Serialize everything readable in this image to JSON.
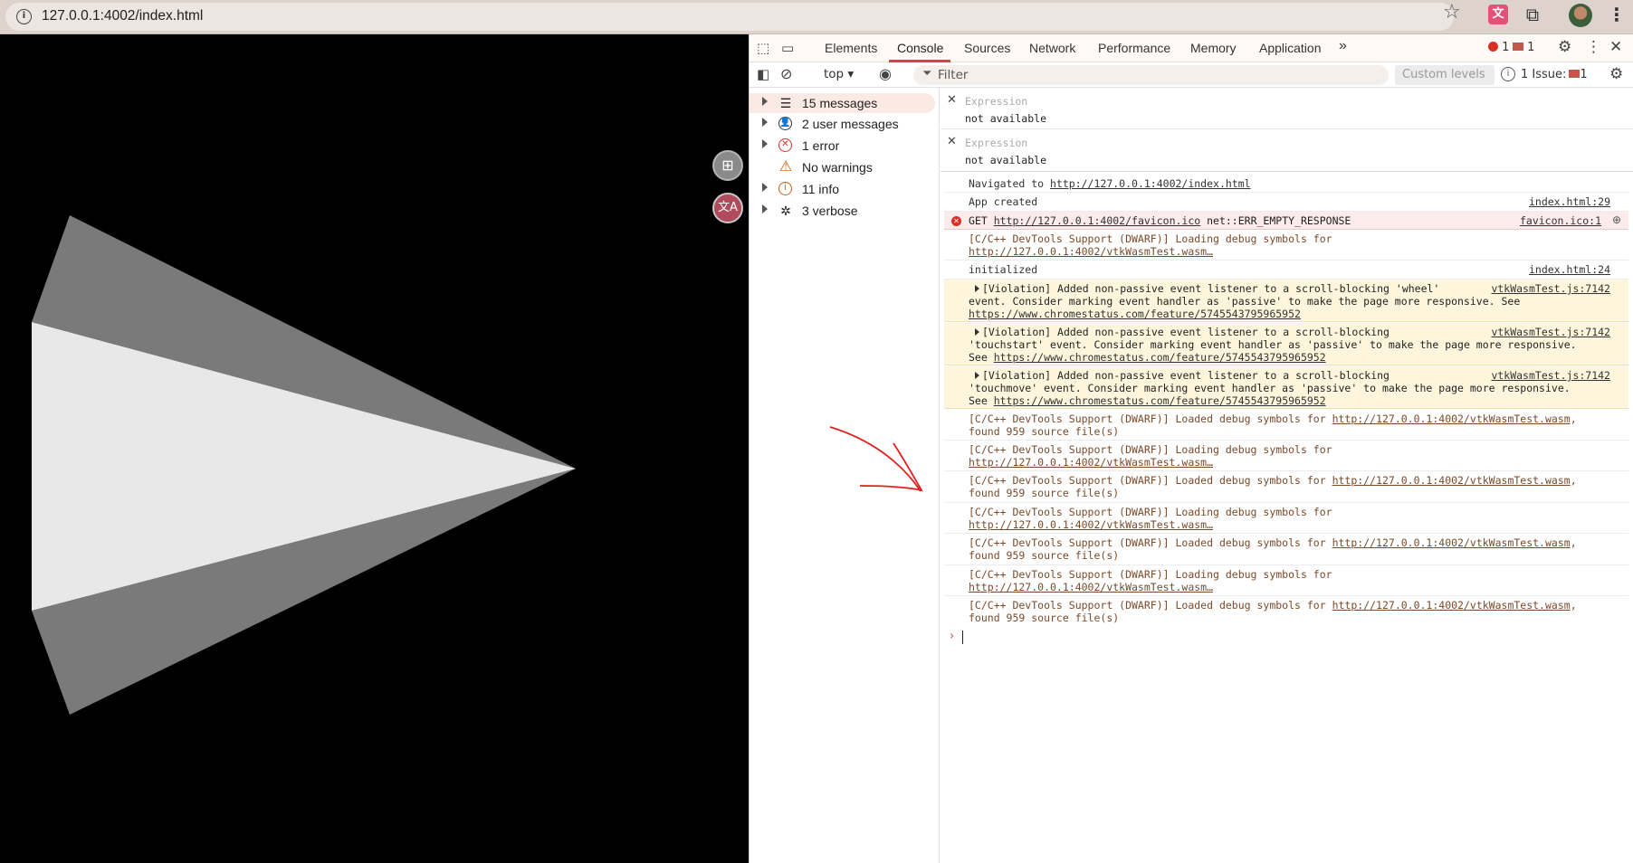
{
  "browser": {
    "url": "127.0.0.1:4002/index.html"
  },
  "devtools": {
    "tabs": [
      "Elements",
      "Console",
      "Sources",
      "Network",
      "Performance",
      "Memory",
      "Application"
    ],
    "active_tab": "Console",
    "more_tabs": "»",
    "error_count": "1",
    "message_count": "1",
    "context": "top ▾",
    "filter_placeholder": "Filter",
    "levels": "Custom levels ▾",
    "issues": "1 Issue:",
    "issues_count": "1"
  },
  "sidebar": {
    "items": [
      {
        "label": "15 messages",
        "icon": "list-icon"
      },
      {
        "label": "2 user messages",
        "icon": "user-icon"
      },
      {
        "label": "1 error",
        "icon": "error-icon"
      },
      {
        "label": "No warnings",
        "icon": "warning-icon"
      },
      {
        "label": "11 info",
        "icon": "info-icon"
      },
      {
        "label": "3 verbose",
        "icon": "bug-icon"
      }
    ]
  },
  "expressions": [
    {
      "label": "Expression",
      "value": "not available"
    },
    {
      "label": "Expression",
      "value": "not available"
    }
  ],
  "console": {
    "navigated_prefix": "Navigated to ",
    "navigated_url": "http://127.0.0.1:4002/index.html",
    "app_created": "App created",
    "app_created_src": "index.html:29",
    "get_prefix": "GET ",
    "get_url": "http://127.0.0.1:4002/favicon.ico",
    "get_suffix": " net::ERR_EMPTY_RESPONSE",
    "get_src": "favicon.ico:1",
    "dwarf_loading_1": "[C/C++ DevTools Support (DWARF)] Loading debug symbols for",
    "dwarf_loading_url": "http://127.0.0.1:4002/vtkWasmTest.wasm…",
    "initialized": "initialized",
    "initialized_src": "index.html:24",
    "violation_wheel_1": "[Violation] Added non-passive event listener to a scroll-blocking 'wheel'",
    "violation_wheel_2": "event. Consider marking event handler as 'passive' to make the page more responsive. See",
    "violation_link": "https://www.chromestatus.com/feature/5745543795965952",
    "violation_src": "vtkWasmTest.js:7142",
    "violation_touchstart_1": "[Violation] Added non-passive event listener to a scroll-blocking",
    "violation_touchstart_2": "'touchstart' event. Consider marking event handler as 'passive' to make the page more responsive.",
    "see": "See ",
    "violation_touchmove_1": "[Violation] Added non-passive event listener to a scroll-blocking",
    "violation_touchmove_2": "'touchmove' event. Consider marking event handler as 'passive' to make the page more responsive.",
    "dwarf_loaded_prefix": "[C/C++ DevTools Support (DWARF)] Loaded debug symbols for ",
    "dwarf_loaded_url": "http://127.0.0.1:4002/vtkWasmTest.wasm",
    "dwarf_loaded_suffix": ",",
    "dwarf_loaded_found": "found 959 source file(s)",
    "prompt": "›"
  },
  "colors": {
    "accent": "#b5534a",
    "error": "#d93025",
    "viewport_bg": "#000000",
    "cone_light": "#e8e8e8",
    "cone_dark": "#7a7a7a",
    "annotation_arrow": "#e0201e"
  }
}
